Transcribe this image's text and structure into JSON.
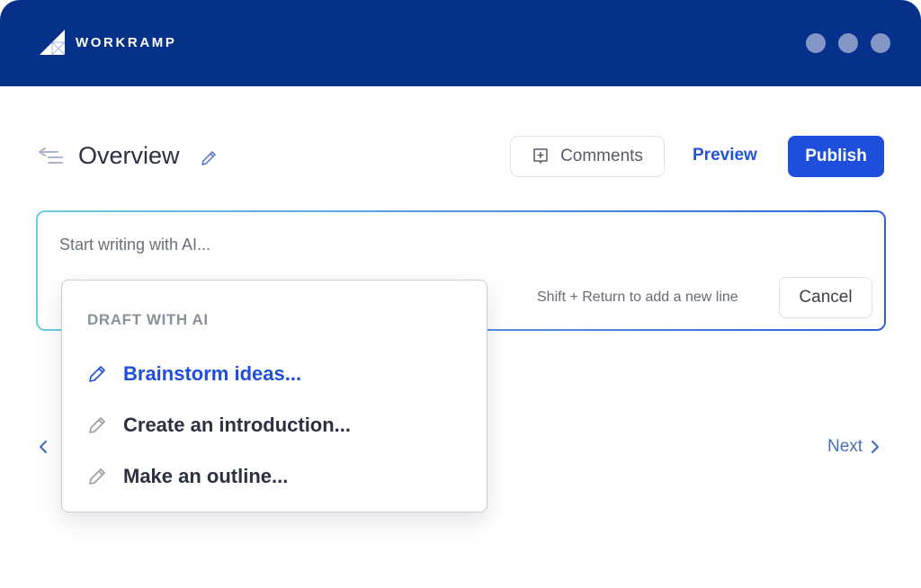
{
  "app": {
    "brand": "WORKRAMP",
    "window_controls": [
      "dot",
      "dot",
      "dot"
    ]
  },
  "header": {
    "title": "Overview",
    "outline_toggle_icon": "collapse-outline-icon",
    "edit_icon": "pencil-icon",
    "comments_label": "Comments",
    "comments_icon": "comment-add-icon",
    "preview_label": "Preview",
    "publish_label": "Publish"
  },
  "ai_box": {
    "placeholder": "Start writing with AI...",
    "value": "",
    "hint": "Shift + Return to add a new line",
    "cancel_label": "Cancel"
  },
  "dropdown": {
    "heading": "DRAFT WITH AI",
    "items": [
      {
        "label": "Brainstorm ideas...",
        "icon": "pencil-icon",
        "active": true
      },
      {
        "label": "Create an introduction...",
        "icon": "pencil-icon",
        "active": false
      },
      {
        "label": "Make an outline...",
        "icon": "pencil-icon",
        "active": false
      }
    ]
  },
  "pagination": {
    "prev_icon": "chevron-left-icon",
    "next_label": "Next",
    "next_icon": "chevron-right-icon"
  },
  "colors": {
    "topbar": "#06318a",
    "accent": "#1e4fdc",
    "link": "#2254d6",
    "nav": "#4a6fc0"
  }
}
